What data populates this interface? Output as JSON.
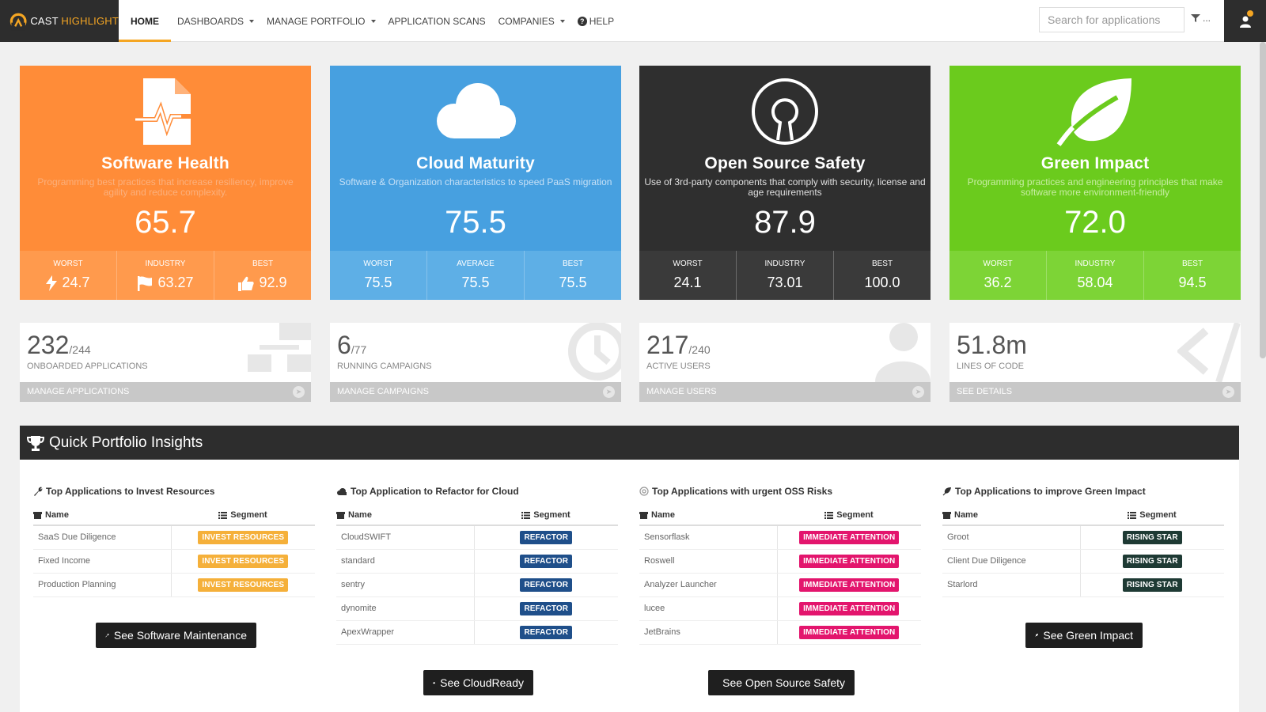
{
  "brand": {
    "name_part1": "CAST ",
    "name_part2": "HIGHLIGHT"
  },
  "nav": {
    "home": "HOME",
    "dashboards": "DASHBOARDS",
    "manage_portfolio": "MANAGE PORTFOLIO",
    "application_scans": "APPLICATION SCANS",
    "companies": "COMPANIES",
    "help": "HELP",
    "search_placeholder": "Search for applications",
    "filter_label": "..."
  },
  "cards": [
    {
      "title": "Software Health",
      "description": "Programming best practices that increase resiliency, improve agility and reduce complexity.",
      "score": "65.7",
      "stats": [
        {
          "label": "WORST",
          "value": "24.7",
          "icon": "bolt-icon"
        },
        {
          "label": "INDUSTRY",
          "value": "63.27",
          "icon": "flag-icon"
        },
        {
          "label": "BEST",
          "value": "92.9",
          "icon": "thumbs-up-icon"
        }
      ]
    },
    {
      "title": "Cloud Maturity",
      "description": "Software & Organization characteristics to speed PaaS migration",
      "score": "75.5",
      "stats": [
        {
          "label": "WORST",
          "value": "75.5"
        },
        {
          "label": "AVERAGE",
          "value": "75.5"
        },
        {
          "label": "BEST",
          "value": "75.5"
        }
      ]
    },
    {
      "title": "Open Source Safety",
      "description": "Use of 3rd-party components that comply with security, license and age requirements",
      "score": "87.9",
      "stats": [
        {
          "label": "WORST",
          "value": "24.1"
        },
        {
          "label": "INDUSTRY",
          "value": "73.01"
        },
        {
          "label": "BEST",
          "value": "100.0"
        }
      ]
    },
    {
      "title": "Green Impact",
      "description": "Programming practices and engineering principles that make software more environment-friendly",
      "score": "72.0",
      "stats": [
        {
          "label": "WORST",
          "value": "36.2"
        },
        {
          "label": "INDUSTRY",
          "value": "58.04"
        },
        {
          "label": "BEST",
          "value": "94.5"
        }
      ]
    }
  ],
  "tiles": [
    {
      "count": "232",
      "total": "/244",
      "label": "ONBOARDED APPLICATIONS",
      "link": "MANAGE APPLICATIONS"
    },
    {
      "count": "6",
      "total": "/77",
      "label": "RUNNING CAMPAIGNS",
      "link": "MANAGE CAMPAIGNS"
    },
    {
      "count": "217",
      "total": "/240",
      "label": "ACTIVE USERS",
      "link": "MANAGE USERS"
    },
    {
      "count": "51.8m",
      "total": "",
      "label": "LINES OF CODE",
      "link": "SEE DETAILS"
    }
  ],
  "insights": {
    "title": "Quick Portfolio Insights",
    "name_header": "Name",
    "segment_header": "Segment",
    "columns": [
      {
        "title": "Top Applications to Invest Resources",
        "button": "See Software Maintenance",
        "rows": [
          {
            "name": "SaaS Due Diligence",
            "segment": "INVEST RESOURCES"
          },
          {
            "name": "Fixed Income",
            "segment": "INVEST RESOURCES"
          },
          {
            "name": "Production Planning",
            "segment": "INVEST RESOURCES"
          }
        ]
      },
      {
        "title": "Top Application to Refactor for Cloud",
        "button": "See CloudReady",
        "rows": [
          {
            "name": "CloudSWIFT",
            "segment": "REFACTOR"
          },
          {
            "name": "standard",
            "segment": "REFACTOR"
          },
          {
            "name": "sentry",
            "segment": "REFACTOR"
          },
          {
            "name": "dynomite",
            "segment": "REFACTOR"
          },
          {
            "name": "ApexWrapper",
            "segment": "REFACTOR"
          }
        ]
      },
      {
        "title": "Top Applications with urgent OSS Risks",
        "button": "See Open Source Safety",
        "rows": [
          {
            "name": "Sensorflask",
            "segment": "IMMEDIATE ATTENTION"
          },
          {
            "name": "Roswell",
            "segment": "IMMEDIATE ATTENTION"
          },
          {
            "name": "Analyzer Launcher",
            "segment": "IMMEDIATE ATTENTION"
          },
          {
            "name": "lucee",
            "segment": "IMMEDIATE ATTENTION"
          },
          {
            "name": "JetBrains",
            "segment": "IMMEDIATE ATTENTION"
          }
        ]
      },
      {
        "title": "Top Applications to improve Green Impact",
        "button": "See Green Impact",
        "rows": [
          {
            "name": "Groot",
            "segment": "RISING STAR"
          },
          {
            "name": "Client Due Diligence",
            "segment": "RISING STAR"
          },
          {
            "name": "Starlord",
            "segment": "RISING STAR"
          }
        ]
      }
    ]
  },
  "colors": {
    "accent": "#f5a623",
    "software_health": "#ff8c38",
    "cloud_maturity": "#47a0e0",
    "open_source_safety": "#2f2f2f",
    "green_impact": "#6bcb1d",
    "invest": "#f5b03a",
    "refactor": "#1f4f8a",
    "immediate": "#e3156d",
    "rising": "#1e3a34"
  }
}
